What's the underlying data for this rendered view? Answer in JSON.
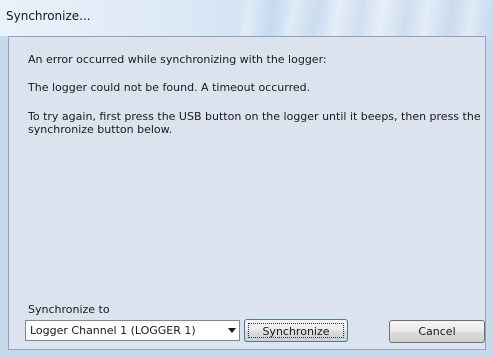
{
  "window": {
    "title": "Synchronize..."
  },
  "message": {
    "line1": "An error occurred while synchronizing with the logger:",
    "line2": "The logger could not be found. A timeout occurred.",
    "line3": "To try again, first press the USB button on the logger until it beeps, then press the synchronize button below."
  },
  "sync": {
    "label": "Synchronize to",
    "selected_channel": "Logger Channel 1 (LOGGER 1)",
    "synchronize_label": "Synchronize",
    "cancel_label": "Cancel"
  },
  "icons": {
    "dropdown": "chevron-down-icon"
  }
}
